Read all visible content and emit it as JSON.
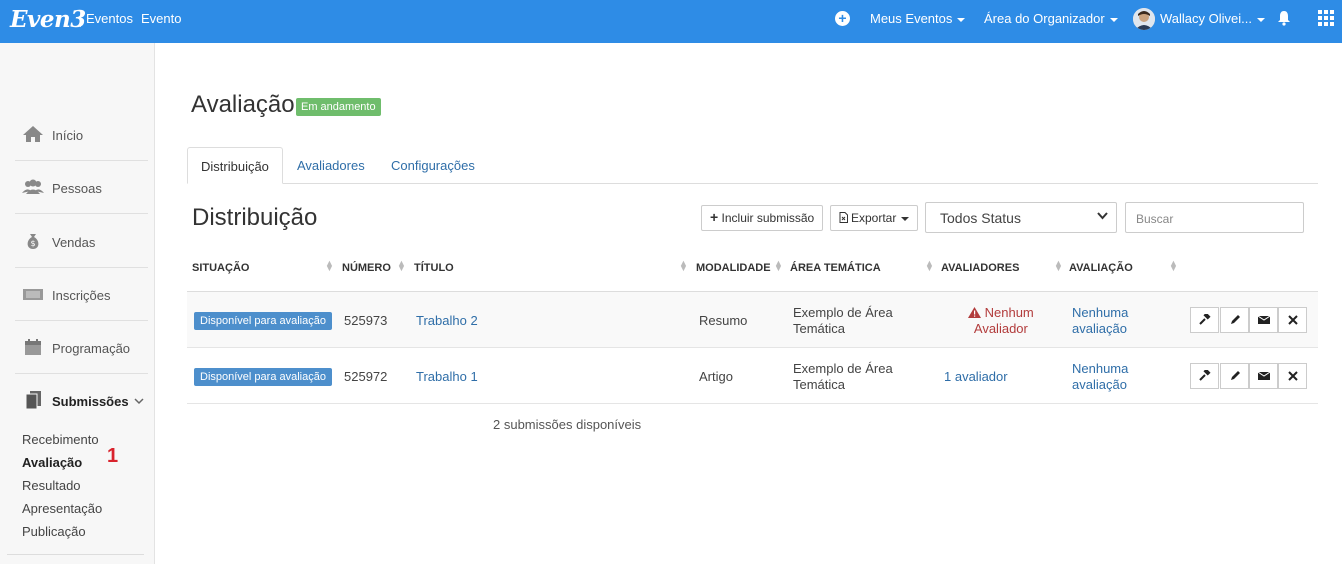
{
  "topbar": {
    "logo": "Even3",
    "nav_eventos": "Eventos",
    "nav_evento": "Evento",
    "meus_eventos": "Meus Eventos",
    "area_organizador": "Área do Organizador",
    "user_name": "Wallacy Olivei..."
  },
  "sidebar": {
    "items": [
      {
        "label": "Início",
        "icon": "home-icon"
      },
      {
        "label": "Pessoas",
        "icon": "people-icon"
      },
      {
        "label": "Vendas",
        "icon": "money-bag-icon"
      },
      {
        "label": "Inscrições",
        "icon": "ticket-icon"
      },
      {
        "label": "Programação",
        "icon": "calendar-icon"
      },
      {
        "label": "Submissões",
        "icon": "document-icon"
      }
    ],
    "subitems": [
      "Recebimento",
      "Avaliação",
      "Resultado",
      "Apresentação",
      "Publicação"
    ],
    "badge": "1"
  },
  "page": {
    "title": "Avaliação",
    "status": "Em andamento"
  },
  "tabs": [
    "Distribuição",
    "Avaliadores",
    "Configurações"
  ],
  "section": {
    "title": "Distribuição",
    "add_button": "Incluir submissão",
    "export_button": "Exportar",
    "status_select": "Todos Status",
    "search_placeholder": "Buscar"
  },
  "table": {
    "headers": [
      "SITUAÇÃO",
      "NÚMERO",
      "TÍTULO",
      "MODALIDADE",
      "ÁREA TEMÁTICA",
      "AVALIADORES",
      "AVALIAÇÃO"
    ],
    "rows": [
      {
        "situacao": "Disponível para avaliação",
        "numero": "525973",
        "titulo": "Trabalho 2",
        "modalidade": "Resumo",
        "area_l1": "Exemplo de Área",
        "area_l2": "Temática",
        "avaliadores_l1": "Nenhum",
        "avaliadores_l2": "Avaliador",
        "avaliacao_l1": "Nenhuma",
        "avaliacao_l2": "avaliação"
      },
      {
        "situacao": "Disponível para avaliação",
        "numero": "525972",
        "titulo": "Trabalho 1",
        "modalidade": "Artigo",
        "area_l1": "Exemplo de Área",
        "area_l2": "Temática",
        "avaliadores_l1": "1 avaliador",
        "avaliacao_l1": "Nenhuma",
        "avaliacao_l2": "avaliação"
      }
    ],
    "footer": "2 submissões disponíveis"
  },
  "colors": {
    "topbar": "#2e8ce6",
    "status_green": "#6fbd6c",
    "label_blue": "#4d8fcc",
    "warning_red": "#b23c3c",
    "badge_red": "#d9232d"
  }
}
